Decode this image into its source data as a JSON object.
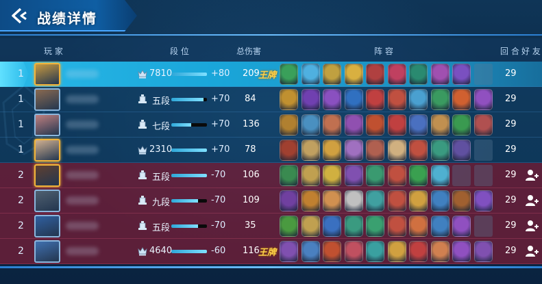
{
  "header": {
    "title": "战绩详情",
    "columns": {
      "player": "玩 家",
      "rank": "段 位",
      "damage": "总伤害",
      "lineup": "阵 容",
      "rounds": "回 合",
      "friend": "好 友"
    }
  },
  "colors": {
    "accent": "#29b8e8",
    "team1_row": "#124670",
    "team2_row": "#781e37",
    "mvp_gold": "#ffd34a"
  },
  "rows": [
    {
      "team": "1",
      "rank_label": "7810",
      "rank_icon": "crown-rank-icon",
      "bar_fill": 1.0,
      "change": "+80",
      "damage": "209",
      "mvp": "王牌",
      "rounds": "29",
      "avatar_border": "gold",
      "units": [
        "#3aa05a",
        "#4fb0e0",
        "#c0a040",
        "#d9b040",
        "#b04040",
        "#c04060",
        "#2a8a70",
        "#a050b0",
        "#7a50c0"
      ],
      "empty": 1,
      "add_friend": false
    },
    {
      "team": "1",
      "rank_label": "五段",
      "rank_icon": "tower-rank-icon",
      "bar_fill": 0.9,
      "change": "+70",
      "damage": "84",
      "mvp": "",
      "rounds": "29",
      "avatar_border": "normal",
      "units": [
        "#c09030",
        "#7040b0",
        "#8a50c0",
        "#3070c0",
        "#c04040",
        "#c05040",
        "#4aa0d0",
        "#3a9a60",
        "#d06030",
        "#9050c0"
      ],
      "empty": 0,
      "add_friend": false
    },
    {
      "team": "1",
      "rank_label": "七段",
      "rank_icon": "tower-rank-icon",
      "bar_fill": 0.55,
      "change": "+70",
      "damage": "136",
      "mvp": "",
      "rounds": "29",
      "avatar_border": "normal",
      "units": [
        "#b08030",
        "#4a90c0",
        "#c07050",
        "#9050b0",
        "#c05030",
        "#c04040",
        "#4a70c0",
        "#c09050",
        "#3a9a50",
        "#b05050"
      ],
      "empty": 0,
      "add_friend": false
    },
    {
      "team": "1",
      "rank_label": "2310",
      "rank_icon": "crown-rank-icon",
      "bar_fill": 1.0,
      "change": "+70",
      "damage": "78",
      "mvp": "",
      "rounds": "29",
      "avatar_border": "gold",
      "units": [
        "#a04030",
        "#c0a060",
        "#d0a040",
        "#a070c0",
        "#b06050",
        "#d0b080",
        "#c05040",
        "#3a9a80",
        "#6050a0"
      ],
      "empty": 1,
      "add_friend": false
    },
    {
      "team": "2",
      "rank_label": "五段",
      "rank_icon": "tower-rank-icon",
      "bar_fill": 1.0,
      "change": "-70",
      "damage": "106",
      "mvp": "",
      "rounds": "29",
      "avatar_border": "gold",
      "units": [
        "#3a8a50",
        "#c0a050",
        "#d0b040",
        "#8050b0",
        "#3a9a70",
        "#c05040",
        "#3aa050",
        "#4fb0d0"
      ],
      "empty": 2,
      "add_friend": true
    },
    {
      "team": "2",
      "rank_label": "九段",
      "rank_icon": "tower-rank-icon",
      "bar_fill": 0.75,
      "change": "-70",
      "damage": "109",
      "mvp": "",
      "rounds": "29",
      "avatar_border": "normal",
      "units": [
        "#7040a0",
        "#c08030",
        "#d09050",
        "#c0c0c0",
        "#40a0a0",
        "#c05040",
        "#d0a040",
        "#4080c0",
        "#a06030",
        "#8050c0"
      ],
      "empty": 0,
      "add_friend": true
    },
    {
      "team": "2",
      "rank_label": "五段",
      "rank_icon": "tower-rank-icon",
      "bar_fill": 0.75,
      "change": "-70",
      "damage": "35",
      "mvp": "",
      "rounds": "29",
      "avatar_border": "normal",
      "units": [
        "#4a9a40",
        "#c0a050",
        "#3a70c0",
        "#3a9a80",
        "#3aa070",
        "#c05040",
        "#d07040",
        "#4080c0",
        "#9050c0"
      ],
      "empty": 1,
      "add_friend": true
    },
    {
      "team": "2",
      "rank_label": "4640",
      "rank_icon": "crown-rank-icon",
      "bar_fill": 1.0,
      "change": "-60",
      "damage": "116",
      "mvp": "王牌",
      "rounds": "29",
      "avatar_border": "normal",
      "units": [
        "#8050b0",
        "#4a80c0",
        "#c05030",
        "#c05060",
        "#3aa0a0",
        "#d0a040",
        "#c04040",
        "#d08050",
        "#9050c0",
        "#8050b0"
      ],
      "empty": 0,
      "add_friend": true
    }
  ]
}
